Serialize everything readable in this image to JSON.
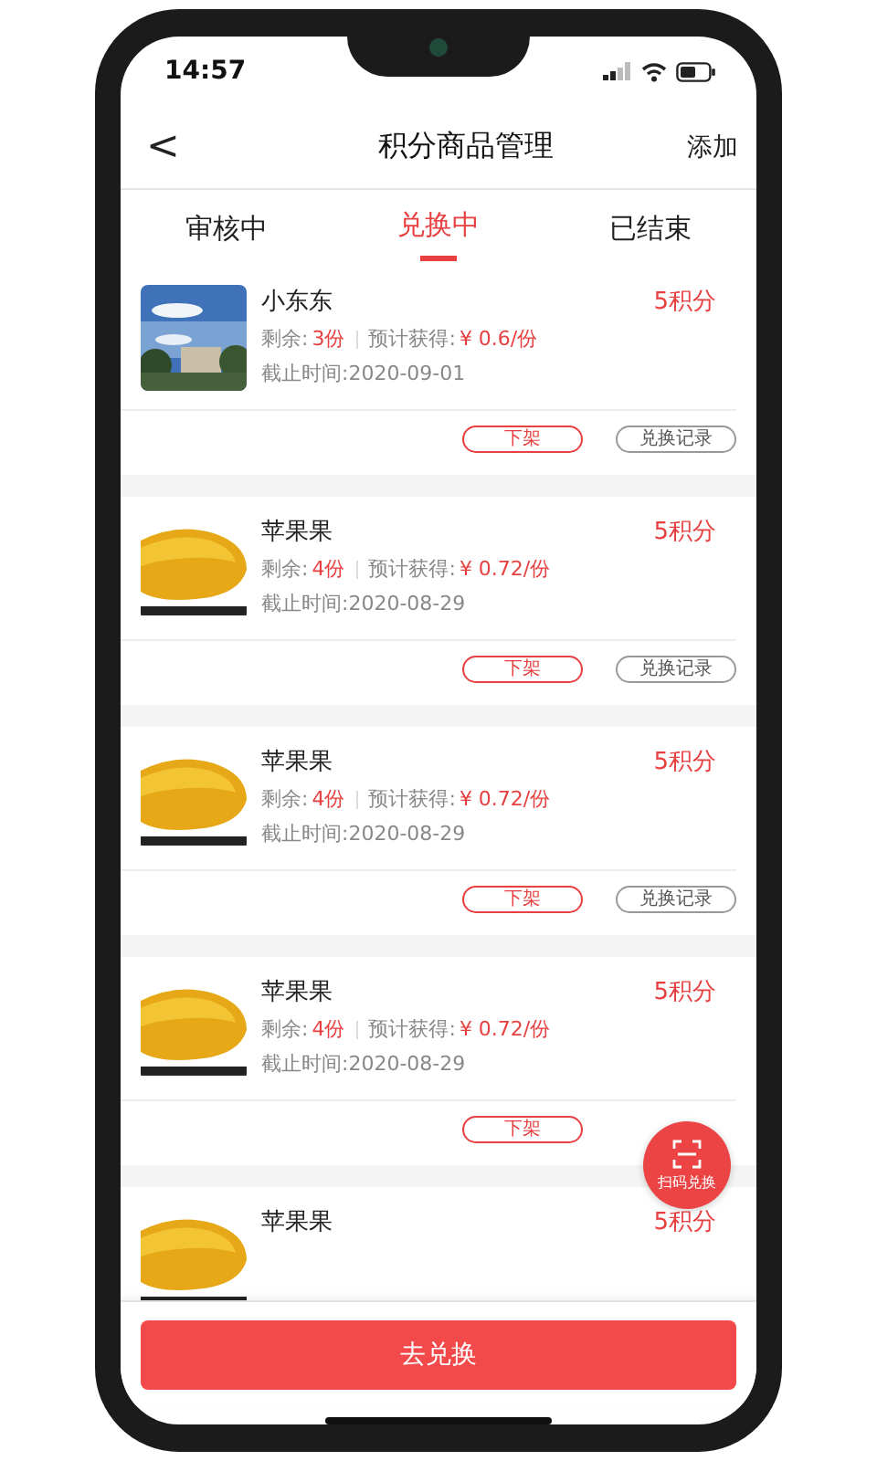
{
  "status_bar": {
    "time": "14:57"
  },
  "nav": {
    "back": "<",
    "title": "积分商品管理",
    "action": "添加"
  },
  "tabs": [
    {
      "label": "审核中",
      "selected": false
    },
    {
      "label": "兑换中",
      "selected": true
    },
    {
      "label": "已结束",
      "selected": false
    }
  ],
  "items": [
    {
      "name": "小东东",
      "points": "5积分",
      "stock_label": "剩余:",
      "stock": "3份",
      "estimate_label": "预计获得:",
      "estimate": "¥ 0.6/份",
      "deadline": "截止时间:2020-09-01",
      "remove_button": "下架",
      "record_button": "兑换记录"
    },
    {
      "name": "苹果果",
      "points": "5积分",
      "stock_label": "剩余:",
      "stock": "4份",
      "estimate_label": "预计获得:",
      "estimate": "¥ 0.72/份",
      "deadline": "截止时间:2020-08-29",
      "remove_button": "下架",
      "record_button": "兑换记录"
    },
    {
      "name": "苹果果",
      "points": "5积分",
      "stock_label": "剩余:",
      "stock": "4份",
      "estimate_label": "预计获得:",
      "estimate": "¥ 0.72/份",
      "deadline": "截止时间:2020-08-29",
      "remove_button": "下架",
      "record_button": "兑换记录"
    },
    {
      "name": "苹果果",
      "points": "5积分",
      "stock_label": "剩余:",
      "stock": "4份",
      "estimate_label": "预计获得:",
      "estimate": "¥ 0.72/份",
      "deadline": "截止时间:2020-08-29",
      "remove_button": "下架"
    },
    {
      "name": "苹果果",
      "points": "5积分"
    }
  ],
  "scan_button": "扫码兑换",
  "bottom_button": "去兑换"
}
